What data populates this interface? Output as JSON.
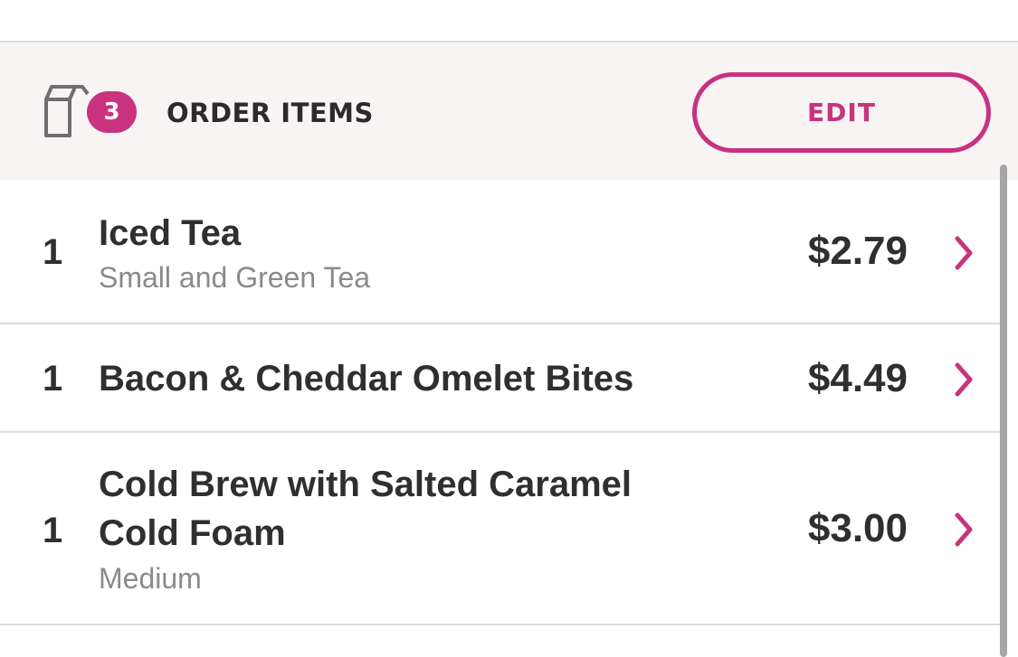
{
  "header": {
    "item_count": "3",
    "title": "ORDER ITEMS",
    "edit_label": "EDIT"
  },
  "items": [
    {
      "qty": "1",
      "name": "Iced Tea",
      "detail": "Small and Green Tea",
      "price": "$2.79"
    },
    {
      "qty": "1",
      "name": "Bacon & Cheddar Omelet Bites",
      "detail": "",
      "price": "$4.49"
    },
    {
      "qty": "1",
      "name": "Cold Brew with Salted Caramel Cold Foam",
      "detail": "Medium",
      "price": "$3.00"
    }
  ],
  "colors": {
    "accent": "#c8327f",
    "header_bg": "#f8f4f4",
    "text": "#2f2f2f",
    "muted": "#8a8a8a",
    "divider": "#dcdcdc"
  },
  "icons": {
    "bag": "shopping-bag-icon",
    "chevron": "chevron-right-icon"
  }
}
